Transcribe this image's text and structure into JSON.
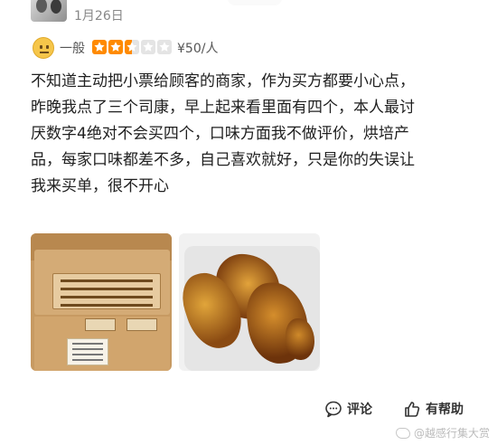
{
  "post": {
    "date": "1月26日"
  },
  "rating": {
    "word": "一般",
    "stars_value": 2.5,
    "stars_max": 5,
    "price": "¥50/人"
  },
  "review": {
    "lines": [
      "不知道主动把小票给顾客的商家，作为买方都要小心点，",
      "昨晚我点了三个司康，早上起来看里面有四个，本人最讨",
      "厌数字4绝对不会买四个，口味方面我不做评价，烘培产",
      "品，每家口味都差不多，自己喜欢就好，只是你的失误让",
      "我来买单，很不开心"
    ]
  },
  "photos": [
    {
      "icon": "boxed-scones-photo"
    },
    {
      "icon": "scones-on-plate-photo"
    }
  ],
  "actions": {
    "comment_label": "评论",
    "helpful_label": "有帮助"
  },
  "watermark": {
    "text": "@越感行集大赏"
  },
  "colors": {
    "star_active": "#ff8a00",
    "star_inactive": "#e4e4e4",
    "emoji": "#f6c64a",
    "date_text": "#888888"
  }
}
